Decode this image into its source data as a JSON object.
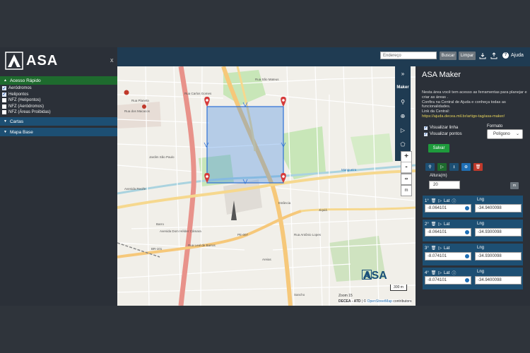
{
  "sidebar": {
    "logo_text": "ASA",
    "close_label": "x",
    "sections": [
      {
        "label": "Acesso Rápido",
        "expanded": true
      },
      {
        "label": "Cartas",
        "expanded": false
      },
      {
        "label": "Mapa Base",
        "expanded": false
      }
    ],
    "layers": [
      {
        "label": "Aeródromos",
        "checked": true
      },
      {
        "label": "Helipontos",
        "checked": true
      },
      {
        "label": "NFZ (Helipontos)",
        "checked": false
      },
      {
        "label": "NFZ (Aeródromos)",
        "checked": false
      },
      {
        "label": "NFZ (Áreas Proibidas)",
        "checked": false
      }
    ]
  },
  "topbar": {
    "address_placeholder": "Endereço",
    "search_label": "Buscar",
    "clear_label": "Limpar",
    "help_label": "Ajuda"
  },
  "map": {
    "maker_label": "Maker",
    "zoom_in": "+",
    "zoom_out": "-",
    "measure_label": "m",
    "scale_label": "300 m",
    "zoom_level": "Zoom 15",
    "attribution_owner": "DECEA - ATD",
    "attribution_sep": " | © ",
    "attribution_link": "OpenStreetMap",
    "attribution_rest": " contributors",
    "watermark_text": "ASA",
    "labels": [
      "Rua São Mateus",
      "Jardim São Paulo",
      "Jiquiá",
      "Mangueira",
      "Barro",
      "Areias",
      "Estância",
      "Rua Planeta",
      "Rua dos Macacos",
      "BR-101",
      "Avenida Recife",
      "PE-007",
      "Rua Leal de Barros",
      "Rua Antônio Lopes",
      "Avenida Dom Hélder Câmara",
      "Rua Carlos Gomes",
      "Sancho"
    ]
  },
  "panel": {
    "title": "ASA Maker",
    "desc1": "Nesta área você tem acesso as ferramentas para planejar e criar as áreas .",
    "desc2": "Confira na Central de Ajuda e conheça todas as funcionalidades.",
    "desc3": "Link da Central:",
    "link": "https://ajuda.decea.mil.br/artigo-tag/asa-maker/",
    "show_line": "Visualizar linha",
    "show_points": "Visualizar pontos",
    "format_label": "Formato",
    "format_value": "Polígono",
    "save_label": "Salvar",
    "altitude_label": "Altura(m)",
    "altitude_value": "20",
    "altitude_unit": "m",
    "lat_label": "Lat",
    "lng_label": "Lng",
    "points": [
      {
        "idx": "1°",
        "lat": "-8.064101",
        "lng": "-34.9400098"
      },
      {
        "idx": "2°",
        "lat": "-8.064101",
        "lng": "-34.9300098"
      },
      {
        "idx": "3°",
        "lat": "-8.074101",
        "lng": "-34.9300098"
      },
      {
        "idx": "4°",
        "lat": "-8.074101",
        "lng": "-34.9400098"
      }
    ]
  }
}
